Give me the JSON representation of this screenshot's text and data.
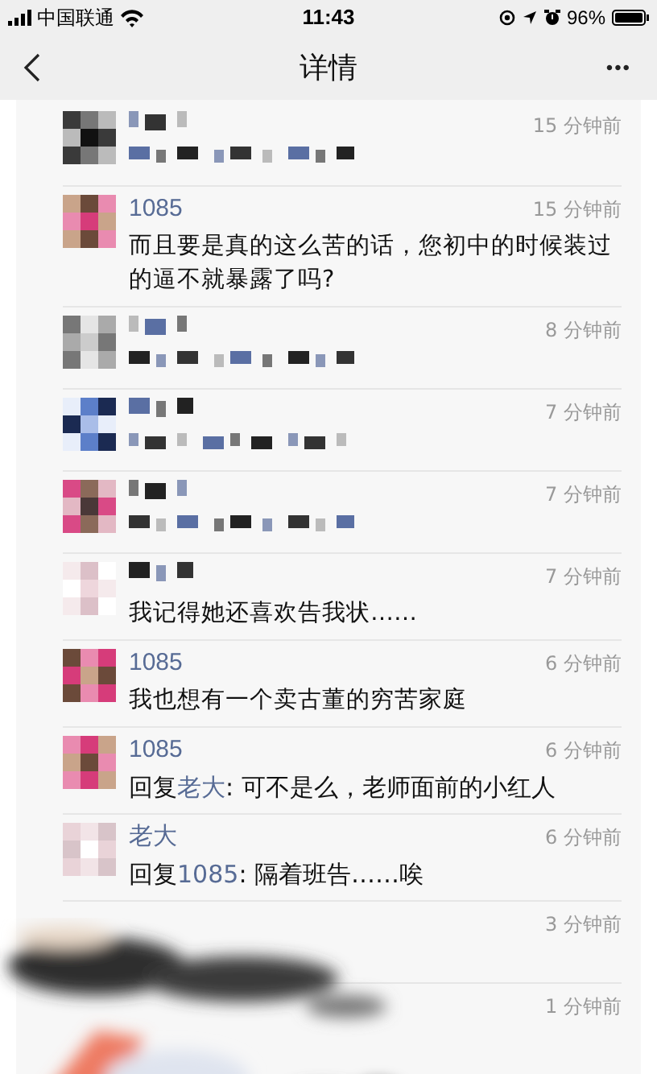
{
  "status_bar": {
    "carrier": "中国联通",
    "time": "11:43",
    "battery": "96%"
  },
  "nav": {
    "title": "详情",
    "more": "•••"
  },
  "comments": [
    {
      "name": {
        "kind": "redacted"
      },
      "body": {
        "kind": "redacted"
      },
      "time": "15 分钟前"
    },
    {
      "name": {
        "kind": "text",
        "text": "1085"
      },
      "body": {
        "kind": "text",
        "text": "而且要是真的这么苦的话，您初中的时候装过的逼不就暴露了吗?"
      },
      "time": "15 分钟前"
    },
    {
      "name": {
        "kind": "redacted"
      },
      "body": {
        "kind": "redacted"
      },
      "time": "8 分钟前"
    },
    {
      "name": {
        "kind": "redacted"
      },
      "body": {
        "kind": "redacted"
      },
      "time": "7 分钟前"
    },
    {
      "name": {
        "kind": "redacted"
      },
      "body": {
        "kind": "redacted"
      },
      "time": "7 分钟前"
    },
    {
      "name": {
        "kind": "redacted"
      },
      "body": {
        "kind": "text",
        "text": "我记得她还喜欢告我状……"
      },
      "time": "7 分钟前"
    },
    {
      "name": {
        "kind": "text",
        "text": "1085"
      },
      "body": {
        "kind": "text",
        "text": "我也想有一个卖古董的穷苦家庭"
      },
      "time": "6 分钟前"
    },
    {
      "name": {
        "kind": "text",
        "text": "1085"
      },
      "body": {
        "kind": "reply",
        "label": "回复",
        "to": "老大",
        "text": ": 可不是么，老师面前的小红人"
      },
      "time": "6 分钟前"
    },
    {
      "name": {
        "kind": "text",
        "text": "老大"
      },
      "body": {
        "kind": "reply",
        "label": "回复",
        "to": "1085",
        "text": ": 隔着班告……唉"
      },
      "time": "6 分钟前"
    },
    {
      "time": "3 分钟前"
    },
    {
      "time": "1 分钟前"
    }
  ]
}
